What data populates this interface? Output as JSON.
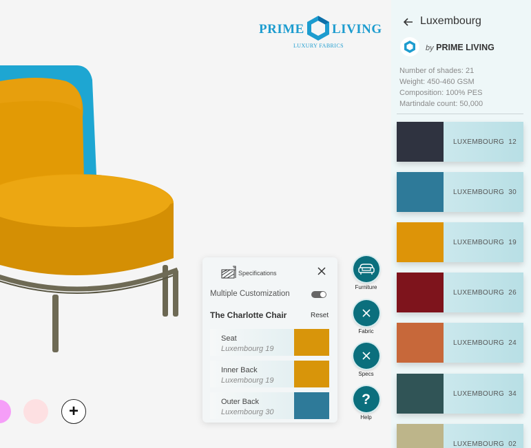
{
  "brand": {
    "word1": "PRIME",
    "word2": "LIVING",
    "tagline": "LUXURY FABRICS",
    "color": "#1d9ccf"
  },
  "canvas": {
    "swatches": [
      {
        "name": "pink",
        "color": "#f59ef8"
      },
      {
        "name": "rose",
        "color": "#fde0e2"
      }
    ],
    "add_swatch_label": "+"
  },
  "specs_panel": {
    "title": "Specifications",
    "multiple_customization_label": "Multiple Customization",
    "multiple_customization_on": true,
    "chair_name": "The Charlotte Chair",
    "reset_label": "Reset",
    "parts": [
      {
        "name": "Seat",
        "fabric": "Luxembourg 19",
        "color": "#d8950a"
      },
      {
        "name": "Inner Back",
        "fabric": "Luxembourg 19",
        "color": "#d8950a"
      },
      {
        "name": "Outer Back",
        "fabric": "Luxembourg 30",
        "color": "#2e7a99"
      }
    ]
  },
  "actions": [
    {
      "label": "Furniture",
      "icon": "sofa-icon"
    },
    {
      "label": "Fabric",
      "icon": "close-icon"
    },
    {
      "label": "Specs",
      "icon": "close-icon"
    },
    {
      "label": "Help",
      "icon": "help-icon"
    }
  ],
  "sidebar": {
    "title": "Luxembourg",
    "by_label": "by",
    "brand_name": "PRIME LIVING",
    "info": [
      "Number of shades: 21",
      "Weight: 450-460 GSM",
      "Composition: 100% PES",
      "Martindale count: 50,000"
    ],
    "fabrics": [
      {
        "name": "LUXEMBOURG",
        "code": "12",
        "color": "#2f3340"
      },
      {
        "name": "LUXEMBOURG",
        "code": "30",
        "color": "#2e7a99"
      },
      {
        "name": "LUXEMBOURG",
        "code": "19",
        "color": "#dd9408"
      },
      {
        "name": "LUXEMBOURG",
        "code": "26",
        "color": "#7e141c"
      },
      {
        "name": "LUXEMBOURG",
        "code": "24",
        "color": "#c7683a"
      },
      {
        "name": "LUXEMBOURG",
        "code": "34",
        "color": "#305456"
      },
      {
        "name": "LUXEMBOURG",
        "code": "02",
        "color": "#bdb58a"
      }
    ]
  },
  "colors": {
    "accent": "#0b6f7d",
    "chair_seat": "#e39b06",
    "chair_outer_back": "#1ea6d2",
    "chair_frame": "#6e6a55"
  }
}
